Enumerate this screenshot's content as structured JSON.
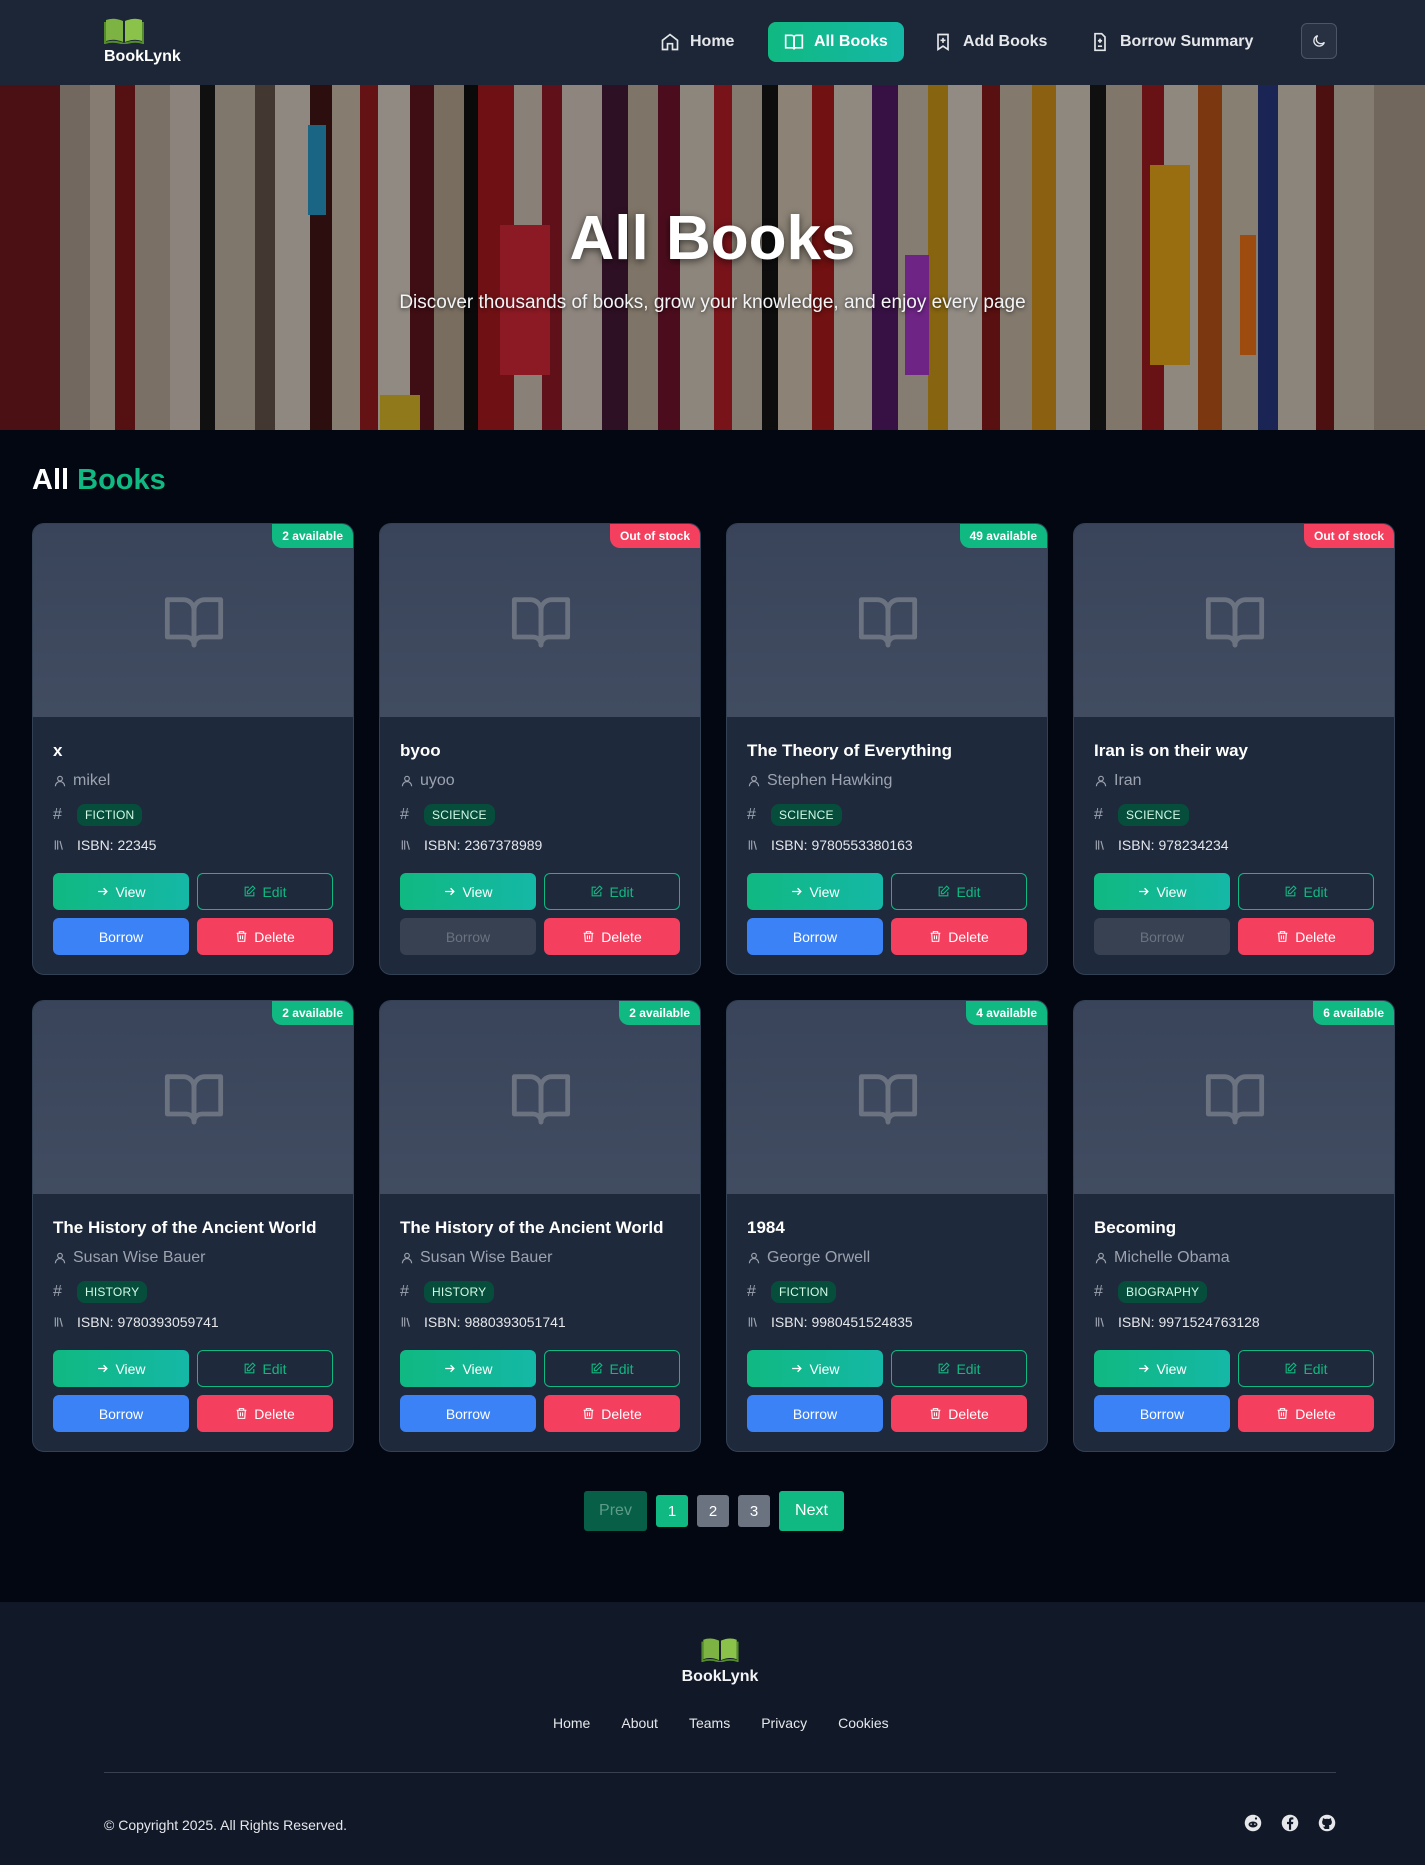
{
  "nav": {
    "brand": "BookLynk",
    "items": [
      {
        "label": "Home",
        "icon": "home-icon",
        "active": false
      },
      {
        "label": "All Books",
        "icon": "open-book-icon",
        "active": true
      },
      {
        "label": "Add Books",
        "icon": "bookmark-plus-icon",
        "active": false
      },
      {
        "label": "Borrow Summary",
        "icon": "file-plus-minus-icon",
        "active": false
      }
    ],
    "theme_toggle_icon": "moon-icon"
  },
  "hero": {
    "title": "All Books",
    "subtitle": "Discover thousands of books, grow your knowledge, and enjoy every page"
  },
  "section": {
    "title_part1": "All",
    "title_part2": "Books"
  },
  "buttons": {
    "view": "View",
    "edit": "Edit",
    "borrow": "Borrow",
    "delete": "Delete"
  },
  "books": [
    {
      "title": "x",
      "author": "mikel",
      "genre": "FICTION",
      "isbn": "ISBN: 22345",
      "stock": "2 available",
      "in_stock": true
    },
    {
      "title": "byoo",
      "author": "uyoo",
      "genre": "SCIENCE",
      "isbn": "ISBN: 2367378989",
      "stock": "Out of stock",
      "in_stock": false
    },
    {
      "title": "The Theory of Everything",
      "author": "Stephen Hawking",
      "genre": "SCIENCE",
      "isbn": "ISBN: 9780553380163",
      "stock": "49 available",
      "in_stock": true
    },
    {
      "title": "Iran is on their way",
      "author": "Iran",
      "genre": "SCIENCE",
      "isbn": "ISBN: 978234234",
      "stock": "Out of stock",
      "in_stock": false
    },
    {
      "title": "The History of the Ancient World",
      "author": "Susan Wise Bauer",
      "genre": "HISTORY",
      "isbn": "ISBN: 9780393059741",
      "stock": "2 available",
      "in_stock": true
    },
    {
      "title": "The History of the Ancient World",
      "author": "Susan Wise Bauer",
      "genre": "HISTORY",
      "isbn": "ISBN: 9880393051741",
      "stock": "2 available",
      "in_stock": true
    },
    {
      "title": "1984",
      "author": "George Orwell",
      "genre": "FICTION",
      "isbn": "ISBN: 9980451524835",
      "stock": "4 available",
      "in_stock": true
    },
    {
      "title": "Becoming",
      "author": "Michelle Obama",
      "genre": "BIOGRAPHY",
      "isbn": "ISBN: 9971524763128",
      "stock": "6 available",
      "in_stock": true
    }
  ],
  "pagination": {
    "prev": "Prev",
    "pages": [
      "1",
      "2",
      "3"
    ],
    "current": "1",
    "next": "Next"
  },
  "footer": {
    "brand": "BookLynk",
    "links": [
      "Home",
      "About",
      "Teams",
      "Privacy",
      "Cookies"
    ],
    "copyright": "© Copyright 2025. All Rights Reserved.",
    "socials": [
      "reddit-icon",
      "facebook-icon",
      "github-icon"
    ]
  },
  "colors": {
    "accent": "#10b981",
    "danger": "#f43f5e",
    "primary": "#3b82f6",
    "background": "#030712",
    "card": "#1e293b"
  }
}
